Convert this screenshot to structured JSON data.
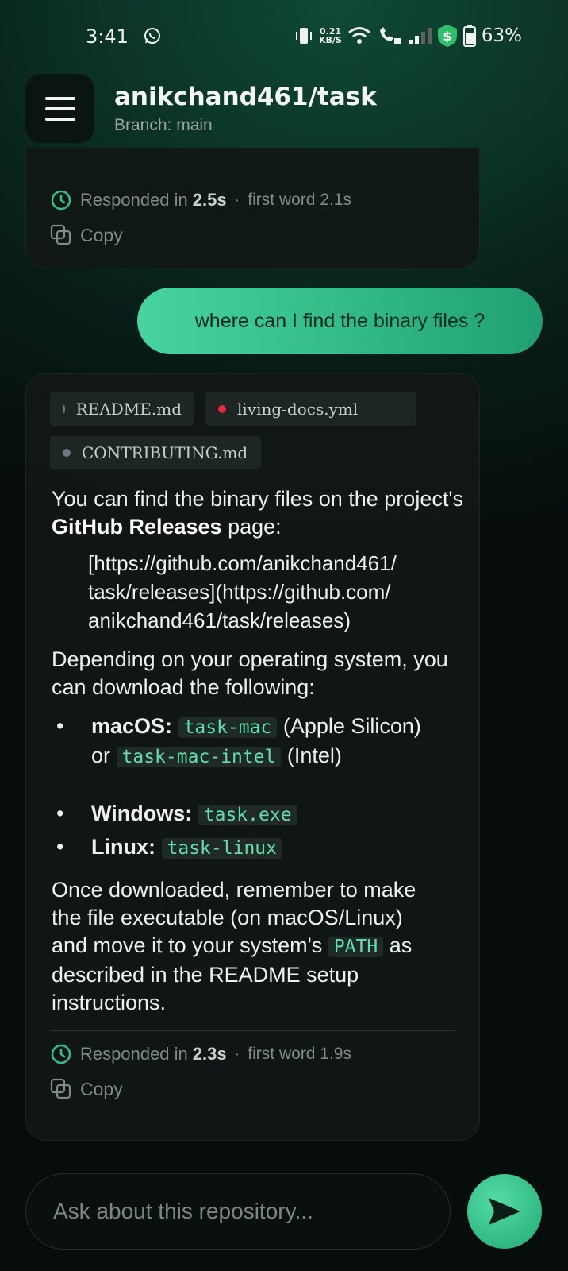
{
  "status_bar": {
    "time": "3:41",
    "net_speed_value": "0.21",
    "net_speed_unit": "KB/S",
    "battery": "63%"
  },
  "header": {
    "repo": "anikchand461/task",
    "branch": "Branch: main"
  },
  "prev_response": {
    "responded_prefix": "Responded in",
    "responded_time": "2.5s",
    "separator": "·",
    "first_word": "first word 2.1s",
    "copy_label": "Copy"
  },
  "user_message": "where can I find the binary files ?",
  "response": {
    "files": [
      {
        "name": "README.md",
        "status_color": "#6b7a85"
      },
      {
        "name": "living-docs.yml",
        "status_color": "#e62a3a"
      },
      {
        "name": "CONTRIBUTING.md",
        "status_color": "#6b7a85"
      }
    ],
    "intro_1": "You can find the binary files on the project's ",
    "intro_bold": "GitHub Releases",
    "intro_2": " page:",
    "link_text": "[https://github.com/anikchand461/task/releases](https://github.com/anikchand461/task/releases)",
    "link_lines": [
      "[https://github.com/anikchand461/",
      "task/releases](https://github.com/",
      "anikchand461/task/releases)"
    ],
    "depending": "Depending on your operating system, you can download the following:",
    "items": [
      {
        "label": "macOS:",
        "code1": "task-mac",
        "mid": " (Apple Silicon) or ",
        "code2": "task-mac-intel",
        "tail": " (Intel)"
      },
      {
        "label": "Windows:",
        "code1": "task.exe"
      },
      {
        "label": "Linux:",
        "code1": "task-linux"
      }
    ],
    "bullet": "•",
    "outro_1": "Once downloaded, remember to make the file executable (on macOS/Linux) and move it to your system's ",
    "outro_code": "PATH",
    "outro_2": " as described in the README setup instructions.",
    "responded_prefix": "Responded in",
    "responded_time": "2.3s",
    "separator": "·",
    "first_word": "first word 1.9s",
    "copy_label": "Copy"
  },
  "composer": {
    "placeholder": "Ask about this repository..."
  },
  "colors": {
    "accent": "#36be88",
    "code_text": "#5fe0ad"
  }
}
